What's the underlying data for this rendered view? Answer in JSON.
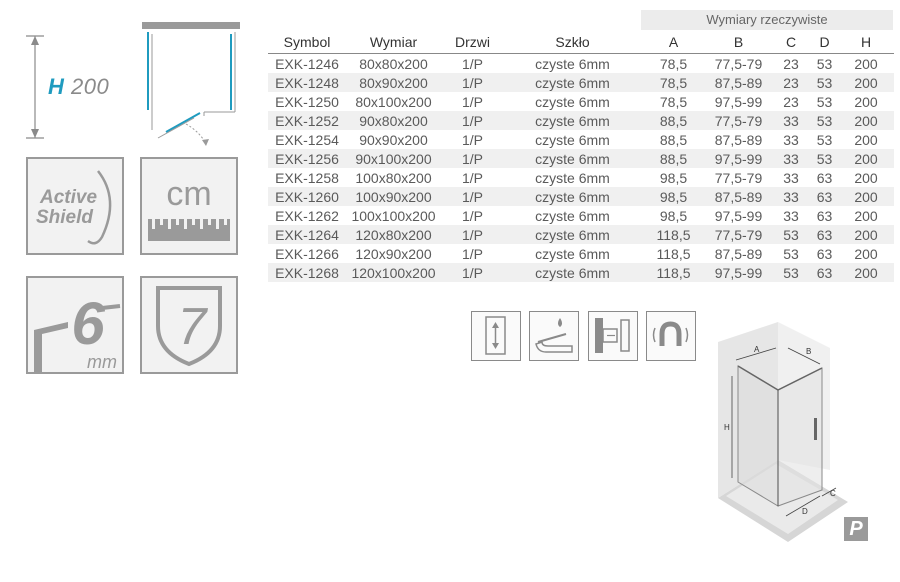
{
  "left": {
    "height_prefix": "H",
    "height_value": "200",
    "badges": {
      "active_shield_line1": "Active",
      "active_shield_line2": "Shield",
      "cm_label": "cm",
      "thickness_value": "6",
      "thickness_unit": "mm",
      "warranty_years": "7"
    }
  },
  "table": {
    "super_header": "Wymiary rzeczywiste",
    "headers": {
      "symbol": "Symbol",
      "wymiar": "Wymiar",
      "drzwi": "Drzwi",
      "szklo": "Szkło",
      "a": "A",
      "b": "B",
      "c": "C",
      "d": "D",
      "h": "H"
    },
    "rows": [
      [
        "EXK-1246",
        "80x80x200",
        "1/P",
        "czyste 6mm",
        "78,5",
        "77,5-79",
        "23",
        "53",
        "200"
      ],
      [
        "EXK-1248",
        "80x90x200",
        "1/P",
        "czyste 6mm",
        "78,5",
        "87,5-89",
        "23",
        "53",
        "200"
      ],
      [
        "EXK-1250",
        "80x100x200",
        "1/P",
        "czyste 6mm",
        "78,5",
        "97,5-99",
        "23",
        "53",
        "200"
      ],
      [
        "EXK-1252",
        "90x80x200",
        "1/P",
        "czyste 6mm",
        "88,5",
        "77,5-79",
        "33",
        "53",
        "200"
      ],
      [
        "EXK-1254",
        "90x90x200",
        "1/P",
        "czyste 6mm",
        "88,5",
        "87,5-89",
        "33",
        "53",
        "200"
      ],
      [
        "EXK-1256",
        "90x100x200",
        "1/P",
        "czyste 6mm",
        "88,5",
        "97,5-99",
        "33",
        "53",
        "200"
      ],
      [
        "EXK-1258",
        "100x80x200",
        "1/P",
        "czyste 6mm",
        "98,5",
        "77,5-79",
        "33",
        "63",
        "200"
      ],
      [
        "EXK-1260",
        "100x90x200",
        "1/P",
        "czyste 6mm",
        "98,5",
        "87,5-89",
        "33",
        "63",
        "200"
      ],
      [
        "EXK-1262",
        "100x100x200",
        "1/P",
        "czyste 6mm",
        "98,5",
        "97,5-99",
        "33",
        "63",
        "200"
      ],
      [
        "EXK-1264",
        "120x80x200",
        "1/P",
        "czyste 6mm",
        "118,5",
        "77,5-79",
        "53",
        "63",
        "200"
      ],
      [
        "EXK-1266",
        "120x90x200",
        "1/P",
        "czyste 6mm",
        "118,5",
        "87,5-89",
        "53",
        "63",
        "200"
      ],
      [
        "EXK-1268",
        "120x100x200",
        "1/P",
        "czyste 6mm",
        "118,5",
        "97,5-99",
        "53",
        "63",
        "200"
      ]
    ]
  },
  "drawing": {
    "label_a": "A",
    "label_b": "B",
    "label_c": "C",
    "label_d": "D",
    "label_h": "H",
    "badge": "P"
  },
  "features": [
    "door-reversible-icon",
    "easy-clean-glass-icon",
    "hinge-adjust-icon",
    "magnetic-seal-icon"
  ],
  "colors": {
    "accent": "#1f9bbf",
    "icon_gray": "#9a9a9a",
    "row_alt": "#f0f0f0"
  }
}
